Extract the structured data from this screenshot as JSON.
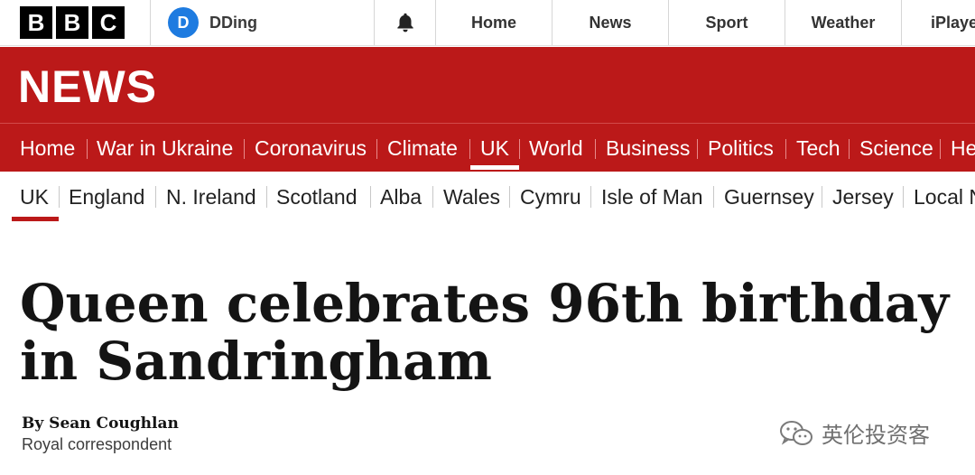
{
  "masthead": {
    "logo_letters": [
      "B",
      "B",
      "C"
    ],
    "account_initial": "D",
    "account_name": "DDing",
    "nav": [
      "Home",
      "News",
      "Sport",
      "Weather",
      "iPlayer"
    ]
  },
  "section": {
    "title": "NEWS",
    "brand_color": "#bb1919"
  },
  "primary_nav": {
    "items": [
      "Home",
      "War in Ukraine",
      "Coronavirus",
      "Climate",
      "UK",
      "World",
      "Business",
      "Politics",
      "Tech",
      "Science",
      "Health"
    ],
    "active": "UK"
  },
  "secondary_nav": {
    "items": [
      "UK",
      "England",
      "N. Ireland",
      "Scotland",
      "Alba",
      "Wales",
      "Cymru",
      "Isle of Man",
      "Guernsey",
      "Jersey",
      "Local News"
    ],
    "active": "UK"
  },
  "article": {
    "headline": "Queen celebrates 96th birthday in Sandringham",
    "byline": "By Sean Coughlan",
    "role": "Royal correspondent"
  },
  "watermark": {
    "text": "英伦投资客",
    "icon": "wechat-icon"
  }
}
